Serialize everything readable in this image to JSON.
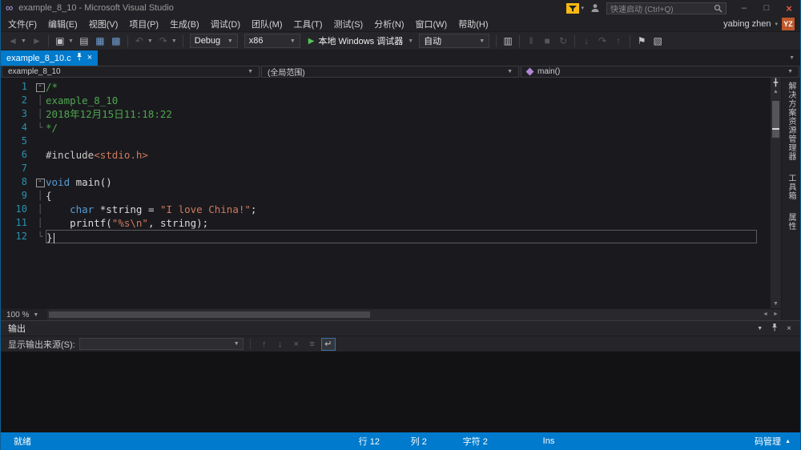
{
  "window": {
    "title": "example_8_10 - Microsoft Visual Studio",
    "quick_launch_placeholder": "快速启动 (Ctrl+Q)",
    "controls": {
      "minimize": "–",
      "maximize": "□",
      "close": "×"
    }
  },
  "menu": {
    "items": [
      {
        "name": "menu-file",
        "label": "文件(F)"
      },
      {
        "name": "menu-edit",
        "label": "编辑(E)"
      },
      {
        "name": "menu-view",
        "label": "视图(V)"
      },
      {
        "name": "menu-project",
        "label": "项目(P)"
      },
      {
        "name": "menu-build",
        "label": "生成(B)"
      },
      {
        "name": "menu-debug",
        "label": "调试(D)"
      },
      {
        "name": "menu-team",
        "label": "团队(M)"
      },
      {
        "name": "menu-tools",
        "label": "工具(T)"
      },
      {
        "name": "menu-test",
        "label": "测试(S)"
      },
      {
        "name": "menu-analyze",
        "label": "分析(N)"
      },
      {
        "name": "menu-window",
        "label": "窗口(W)"
      },
      {
        "name": "menu-help",
        "label": "帮助(H)"
      }
    ],
    "user": "yabing zhen",
    "avatar": "YZ"
  },
  "toolbar": {
    "items": [
      {
        "type": "icon",
        "name": "nav-back-icon",
        "glyph": "◄",
        "enabled": false
      },
      {
        "type": "caret"
      },
      {
        "type": "icon",
        "name": "nav-forward-icon",
        "glyph": "►",
        "enabled": false
      },
      {
        "type": "sep"
      },
      {
        "type": "icon",
        "name": "new-project-icon",
        "glyph": "▣",
        "enabled": true
      },
      {
        "type": "caret"
      },
      {
        "type": "icon",
        "name": "open-file-icon",
        "glyph": "▤",
        "enabled": true
      },
      {
        "type": "icon",
        "name": "save-icon",
        "glyph": "▦",
        "enabled": true,
        "color": "#6f9ccf"
      },
      {
        "type": "icon",
        "name": "save-all-icon",
        "glyph": "▩",
        "enabled": true,
        "color": "#6f9ccf"
      },
      {
        "type": "sep"
      },
      {
        "type": "icon",
        "name": "undo-icon",
        "glyph": "↶",
        "enabled": false
      },
      {
        "type": "caret"
      },
      {
        "type": "icon",
        "name": "redo-icon",
        "glyph": "↷",
        "enabled": false
      },
      {
        "type": "caret"
      },
      {
        "type": "sep"
      },
      {
        "type": "combo",
        "name": "solution-config-combo",
        "value": "Debug",
        "width": 60
      },
      {
        "type": "combo",
        "name": "solution-platform-combo",
        "value": "x86",
        "width": 70
      },
      {
        "type": "run",
        "name": "start-debug-button",
        "label": "本地 Windows 调试器"
      },
      {
        "type": "caret"
      },
      {
        "type": "combo",
        "name": "debug-target-combo",
        "value": "自动",
        "width": 88
      },
      {
        "type": "sep"
      },
      {
        "type": "icon",
        "name": "diagnostics-icon",
        "glyph": "▥",
        "enabled": true
      },
      {
        "type": "sep"
      },
      {
        "type": "icon",
        "name": "break-all-icon",
        "glyph": "‖",
        "enabled": false
      },
      {
        "type": "icon",
        "name": "stop-debug-icon",
        "glyph": "■",
        "enabled": false
      },
      {
        "type": "icon",
        "name": "restart-icon",
        "glyph": "↻",
        "enabled": false
      },
      {
        "type": "sep"
      },
      {
        "type": "icon",
        "name": "step-into-icon",
        "glyph": "↓",
        "enabled": false
      },
      {
        "type": "icon",
        "name": "step-over-icon",
        "glyph": "↷",
        "enabled": false
      },
      {
        "type": "icon",
        "name": "step-out-icon",
        "glyph": "↑",
        "enabled": false
      },
      {
        "type": "sep"
      },
      {
        "type": "icon",
        "name": "bookmark-icon",
        "glyph": "⚑",
        "enabled": true
      },
      {
        "type": "icon",
        "name": "comment-icon",
        "glyph": "▧",
        "enabled": true
      }
    ]
  },
  "tabbar": {
    "tabs": [
      {
        "label": "example_8_10.c",
        "active": true
      }
    ]
  },
  "navbar": {
    "project": "example_8_10",
    "scope": "(全局范围)",
    "member": "main()"
  },
  "editor": {
    "zoom": "100 %",
    "lines": [
      {
        "n": "1",
        "fold": "box",
        "segs": [
          {
            "c": "cmt",
            "t": "/*"
          }
        ]
      },
      {
        "n": "2",
        "fold": "bar",
        "segs": [
          {
            "c": "cmt",
            "t": "example_8_10"
          }
        ]
      },
      {
        "n": "3",
        "fold": "bar",
        "segs": [
          {
            "c": "cmt",
            "t": "2018年12月15日11:18:22"
          }
        ]
      },
      {
        "n": "4",
        "fold": "end",
        "segs": [
          {
            "c": "cmt",
            "t": "*/"
          }
        ]
      },
      {
        "n": "5",
        "fold": "",
        "segs": []
      },
      {
        "n": "6",
        "fold": "",
        "segs": [
          {
            "c": "pre",
            "t": "#include"
          },
          {
            "c": "str",
            "t": "<stdio.h>"
          }
        ]
      },
      {
        "n": "7",
        "fold": "",
        "segs": []
      },
      {
        "n": "8",
        "fold": "box",
        "segs": [
          {
            "c": "kw",
            "t": "void"
          },
          {
            "c": "pln",
            "t": " main()"
          }
        ]
      },
      {
        "n": "9",
        "fold": "bar",
        "segs": [
          {
            "c": "pln",
            "t": "{"
          }
        ]
      },
      {
        "n": "10",
        "fold": "bar",
        "segs": [
          {
            "c": "pln",
            "t": "    "
          },
          {
            "c": "kw",
            "t": "char"
          },
          {
            "c": "pln",
            "t": " *string = "
          },
          {
            "c": "str",
            "t": "\"I love China!\""
          },
          {
            "c": "pln",
            "t": ";"
          }
        ]
      },
      {
        "n": "11",
        "fold": "bar",
        "segs": [
          {
            "c": "pln",
            "t": "    printf("
          },
          {
            "c": "str",
            "t": "\"%s\\n\""
          },
          {
            "c": "pln",
            "t": ", string);"
          }
        ]
      },
      {
        "n": "12",
        "fold": "end",
        "current": true,
        "segs": [
          {
            "c": "pln",
            "t": "}"
          }
        ]
      }
    ]
  },
  "side_panels": [
    {
      "name": "panel-tab-solution-explorer",
      "label": "解决方案资源管理器"
    },
    {
      "name": "panel-tab-toolbox",
      "label": "工具箱"
    },
    {
      "name": "panel-tab-properties",
      "label": "属性"
    }
  ],
  "output": {
    "title": "输出",
    "source_label": "显示输出来源(S):",
    "source_value": "",
    "icons": [
      {
        "name": "previous-message-icon",
        "glyph": "↑",
        "active": false
      },
      {
        "name": "next-message-icon",
        "glyph": "↓",
        "active": false
      },
      {
        "name": "clear-all-icon",
        "glyph": "×",
        "active": false
      },
      {
        "name": "toggle-messages-icon",
        "glyph": "≡",
        "active": false
      },
      {
        "name": "word-wrap-icon",
        "glyph": "↵",
        "active": true
      }
    ]
  },
  "statusbar": {
    "ready": "就绪",
    "line": "行 12",
    "column": "列 2",
    "character": "字符 2",
    "mode": "Ins",
    "source_control": "码管理"
  },
  "colors": {
    "accent": "#007acc",
    "comment": "#4fa64f",
    "keyword": "#569cd6",
    "string": "#cf7a5e",
    "line_number": "#2b91af"
  }
}
